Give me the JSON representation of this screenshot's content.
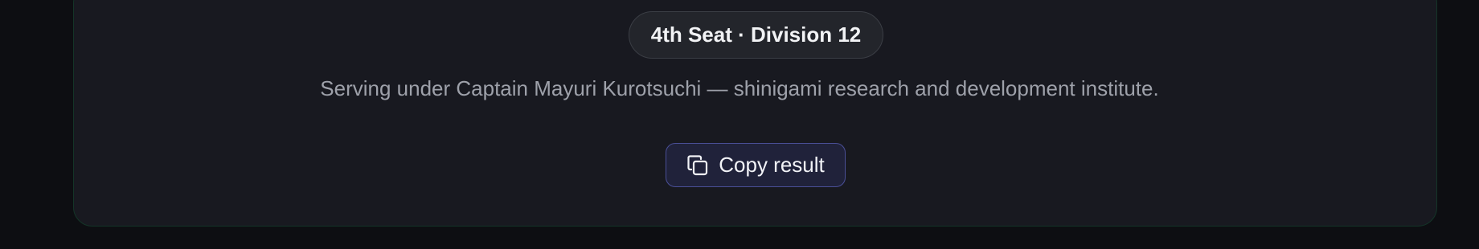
{
  "result": {
    "rank_label": "4th Seat · Division 12",
    "description": "Serving under Captain Mayuri Kurotsuchi — shinigami research and development institute.",
    "copy_button_label": "Copy result",
    "copy_icon": "copy-icon"
  },
  "colors": {
    "page_background": "#0d0e12",
    "card_background": "#181920",
    "card_border": "#143528",
    "pill_background": "#23252b",
    "button_border": "#4a4f97"
  }
}
